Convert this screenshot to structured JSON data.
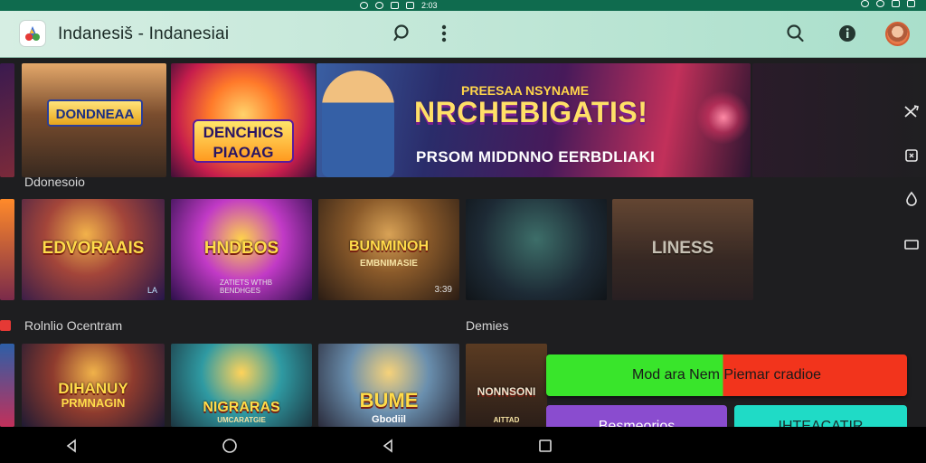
{
  "status_bar": {
    "time": "2:03"
  },
  "app_bar": {
    "title": "Indanesiš - Indanesiai",
    "icons": [
      "app-logo",
      "search-icon",
      "more-vert-icon",
      "search-icon",
      "info-icon",
      "avatar"
    ]
  },
  "hero": {
    "banner1_caption": "DONDNEAA",
    "banner2_caption": "DENCHICS PIAOAG",
    "banner3_kicker": "PREESAA NSYNAME",
    "banner3_title": "NRCHEBIGATIS!",
    "banner3_subtitle": "PRSOM MIDDNNO EERBDLIAKI"
  },
  "sections": {
    "section1": "Ddonesoio",
    "section2": "Rolnlio Ocentram",
    "section3": "Demies"
  },
  "row1": {
    "tile1_caption": "EDVORAAIS",
    "tile1_badge": "LA",
    "tile2_caption": "HNDBOS",
    "tile2_meta": "ZATIETS  WTHB  BENDHGES",
    "tile3_caption": "BUNMINOH",
    "tile3_sub": "EMBNIMASIE",
    "tile3_meta": "3:39",
    "tile5_caption": "LINESS"
  },
  "row2": {
    "tile1_caption": "DIHANUY",
    "tile1_sub": "PRMNAGIN",
    "tile2_caption": "NIGRARAS",
    "tile2_sub": "UMCARATGIE",
    "tile3_caption": "BUME",
    "tile3_sub": "Gbodiil",
    "tile4_caption": "NONNSONI",
    "tile4_sub": "AITTAD"
  },
  "buttons": {
    "mod_button": "Mod ara Nem Piemar cradioe",
    "purple_button": "Besmeorios",
    "cyan_button": "IHTEACATIR"
  },
  "colors": {
    "accent_green": "#39e52b",
    "accent_red": "#f2341c",
    "purple": "#8a4ccf",
    "cyan": "#1fdbc6",
    "status_bar": "#0f6b4e"
  }
}
